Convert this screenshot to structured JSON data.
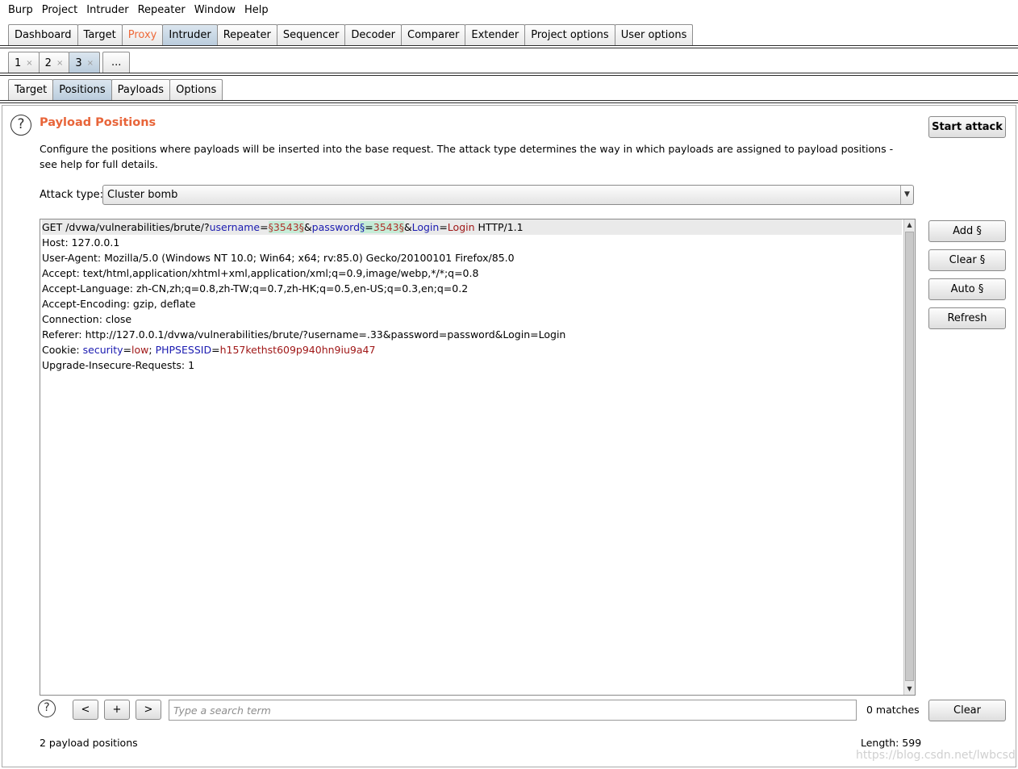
{
  "menu": [
    "Burp",
    "Project",
    "Intruder",
    "Repeater",
    "Window",
    "Help"
  ],
  "main_tabs": [
    {
      "label": "Dashboard",
      "state": "normal"
    },
    {
      "label": "Target",
      "state": "normal"
    },
    {
      "label": "Proxy",
      "state": "highlight"
    },
    {
      "label": "Intruder",
      "state": "active"
    },
    {
      "label": "Repeater",
      "state": "normal"
    },
    {
      "label": "Sequencer",
      "state": "normal"
    },
    {
      "label": "Decoder",
      "state": "normal"
    },
    {
      "label": "Comparer",
      "state": "normal"
    },
    {
      "label": "Extender",
      "state": "normal"
    },
    {
      "label": "Project options",
      "state": "normal"
    },
    {
      "label": "User options",
      "state": "normal"
    }
  ],
  "attack_tabs": [
    {
      "label": "1",
      "close": "×",
      "active": false
    },
    {
      "label": "2",
      "close": "×",
      "active": false
    },
    {
      "label": "3",
      "close": "×",
      "active": true
    }
  ],
  "attack_tabs_more": "...",
  "sub_tabs": [
    {
      "label": "Target",
      "active": false
    },
    {
      "label": "Positions",
      "active": true
    },
    {
      "label": "Payloads",
      "active": false
    },
    {
      "label": "Options",
      "active": false
    }
  ],
  "colors": {
    "accent_orange": "#e8653a",
    "active_tab": "#b9cbdc",
    "param_name": "#1a1ab0",
    "param_value": "#a01818",
    "payload_marker_bg": "#c5ecd7"
  },
  "positions": {
    "help_icon": "?",
    "title": "Payload Positions",
    "description": "Configure the positions where payloads will be inserted into the base request. The attack type determines the way in which payloads are assigned to payload positions - see help for full details.",
    "attack_type_label": "Attack type:",
    "attack_type_value": "Cluster bomb",
    "start_attack": "Start attack",
    "add_button": "Add §",
    "clear_marker_button": "Clear §",
    "auto_button": "Auto §",
    "refresh_button": "Refresh",
    "clear_button": "Clear"
  },
  "request": {
    "line1": {
      "method_path": "GET /dvwa/vulnerabilities/brute/?",
      "p1_name": "username",
      "eq1": "=",
      "p1_payload": "§3543§",
      "amp1": "&",
      "p2_name": "password",
      "p2_marker_start": "§",
      "eq2": "=",
      "p2_payload": "3543§",
      "amp2": "&",
      "p3_name": "Login",
      "eq3": "=",
      "p3_value": "Login",
      "protocol": " HTTP/1.1"
    },
    "headers": [
      "Host: 127.0.0.1",
      "User-Agent: Mozilla/5.0 (Windows NT 10.0; Win64; x64; rv:85.0) Gecko/20100101 Firefox/85.0",
      "Accept: text/html,application/xhtml+xml,application/xml;q=0.9,image/webp,*/*;q=0.8",
      "Accept-Language: zh-CN,zh;q=0.8,zh-TW;q=0.7,zh-HK;q=0.5,en-US;q=0.3,en;q=0.2",
      "Accept-Encoding: gzip, deflate",
      "Connection: close",
      "Referer: http://127.0.0.1/dvwa/vulnerabilities/brute/?username=.33&password=password&Login=Login"
    ],
    "cookie": {
      "prefix": "Cookie: ",
      "c1_name": "security",
      "c1_value": "low",
      "sep": "; ",
      "c2_name": "PHPSESSID",
      "c2_value": "h157kethst609p940hn9iu9a47"
    },
    "last_header": "Upgrade-Insecure-Requests: 1"
  },
  "search": {
    "help_icon": "?",
    "prev": "<",
    "add": "+",
    "next": ">",
    "placeholder": "Type a search term",
    "matches": "0 matches"
  },
  "status": {
    "payload_positions": "2 payload positions",
    "length": "Length: 599"
  },
  "watermark": "https://blog.csdn.net/lwbcsd"
}
